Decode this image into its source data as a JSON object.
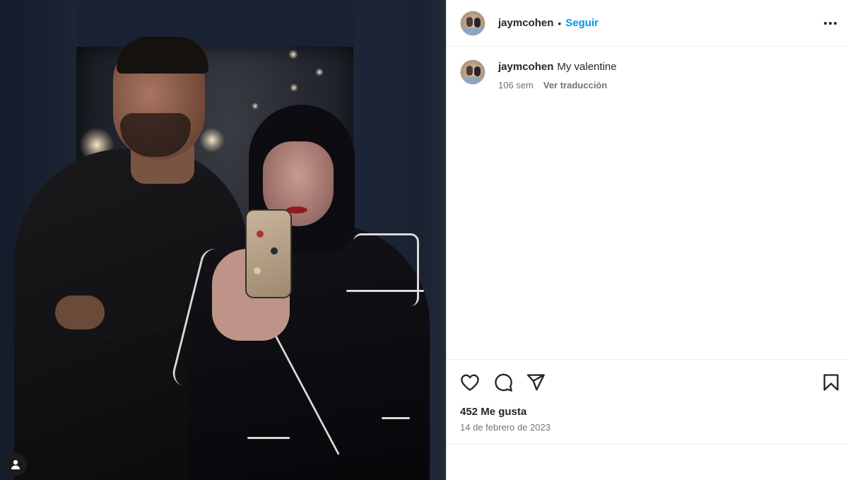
{
  "post": {
    "username": "jaymcohen",
    "follow_label": "Seguir",
    "separator": "•",
    "caption_text": "My valentine",
    "age": "106 sem",
    "translate_label": "Ver traducción",
    "likes": "452 Me gusta",
    "date": "14 de febrero de 2023"
  },
  "icons": {
    "more": "more-options-icon",
    "like": "heart-icon",
    "comment": "comment-icon",
    "share": "share-icon",
    "save": "bookmark-icon",
    "tagged": "user-tag-icon"
  },
  "colors": {
    "follow": "#0095f6",
    "text": "#262626",
    "secondary": "#737373"
  }
}
